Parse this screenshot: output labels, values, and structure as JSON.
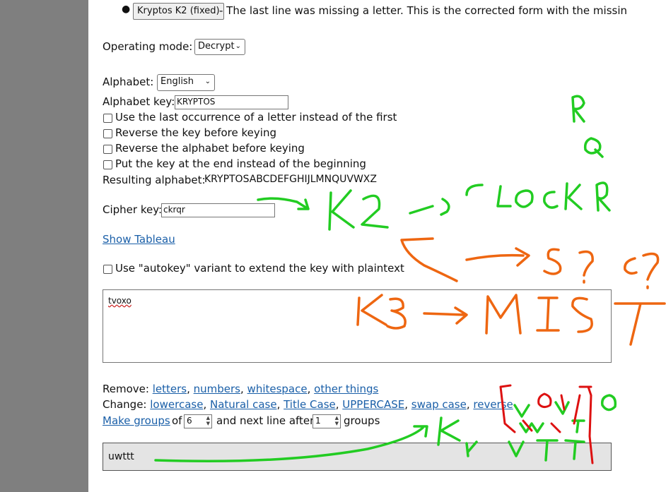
{
  "intro": {
    "button_label": "Kryptos K2 (fixed)",
    "description": "- The last line was missing a letter. This is the corrected form with the missin"
  },
  "mode": {
    "label": "Operating mode:",
    "value": "Decrypt"
  },
  "alphabet": {
    "label": "Alphabet:",
    "value": "English",
    "key_label": "Alphabet key:",
    "key_value": "KRYPTOS",
    "options": [
      "Use the last occurrence of a letter instead of the first",
      "Reverse the key before keying",
      "Reverse the alphabet before keying",
      "Put the key at the end instead of the beginning"
    ],
    "resulting_label": "Resulting alphabet:",
    "resulting_value": "KRYPTOSABCDEFGHIJLMNQUVWXZ"
  },
  "cipher": {
    "label": "Cipher key:",
    "value": "ckrqr"
  },
  "tableau": {
    "link": "Show Tableau"
  },
  "autokey": {
    "label": "Use \"autokey\" variant to extend the key with plaintext"
  },
  "input": {
    "text": "tvoxo"
  },
  "tools": {
    "remove_label": "Remove:",
    "remove_links": [
      "letters",
      "numbers",
      "whitespace",
      "other things"
    ],
    "change_label": "Change:",
    "change_links": [
      "lowercase",
      "Natural case",
      "Title Case",
      "UPPERCASE",
      "swap case",
      "reverse"
    ],
    "groups_link": "Make groups",
    "of_text": "of",
    "group_size": "6",
    "next_line_text": "and next line after",
    "line_groups": "1",
    "groups_text": "groups"
  },
  "output": {
    "text": "uwttt"
  },
  "annotations": {
    "green_color": "#22cc22",
    "orange_color": "#ee6611",
    "red_color": "#dd1111",
    "green_texts": [
      "R",
      "Q",
      "K2",
      "CLOCKR",
      "K4",
      "V",
      "V",
      "W",
      "T",
      "T",
      "T",
      "O"
    ],
    "orange_texts": [
      "S",
      "?",
      "C?",
      "K3",
      "MIST",
      "T",
      "O",
      "X"
    ]
  }
}
